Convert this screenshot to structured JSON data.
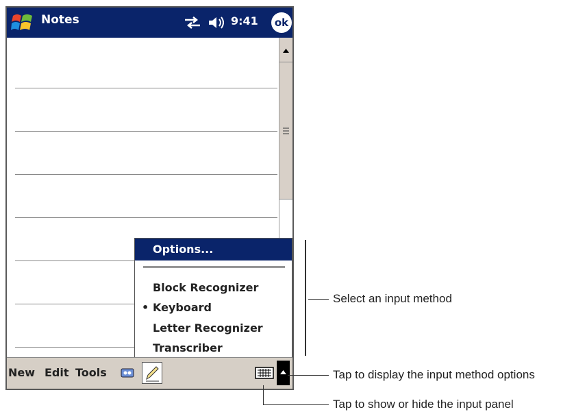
{
  "titlebar": {
    "app_title": "Notes",
    "clock": "9:41",
    "ok_label": "ok"
  },
  "input_menu": {
    "header": "Options...",
    "items": [
      {
        "label": "Block Recognizer",
        "selected": false
      },
      {
        "label": "Keyboard",
        "selected": true
      },
      {
        "label": "Letter Recognizer",
        "selected": false
      },
      {
        "label": "Transcriber",
        "selected": false
      }
    ],
    "selected_marker": "•"
  },
  "menubar": {
    "items": [
      "New",
      "Edit",
      "Tools"
    ]
  },
  "callouts": {
    "select_method": "Select an input method",
    "display_options": "Tap to display the input method options",
    "show_hide_panel": "Tap to show or hide the input panel"
  },
  "colors": {
    "title_bar": "#0a246a",
    "menu_bar": "#d6cfc6",
    "scroll_track": "#d8d0c8"
  }
}
